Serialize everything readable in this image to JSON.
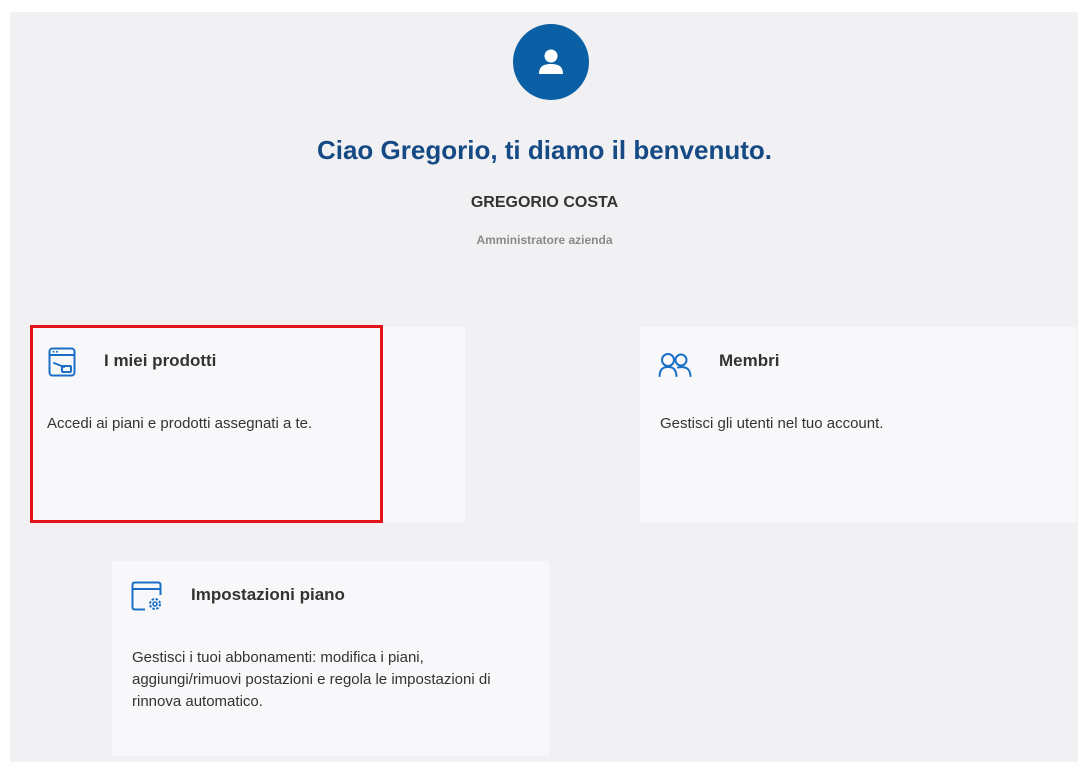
{
  "header": {
    "avatar_icon": "user-icon",
    "greeting": "Ciao Gregorio, ti diamo il benvenuto.",
    "user_name": "GREGORIO COSTA",
    "user_role": "Amministratore azienda"
  },
  "cards": [
    {
      "icon": "products-window-icon",
      "title": "I miei prodotti",
      "description": "Accedi ai piani e prodotti assegnati a te.",
      "highlighted": true
    },
    {
      "icon": "members-icon",
      "title": "Membri",
      "description": "Gestisci gli utenti nel tuo account.",
      "highlighted": false
    },
    {
      "icon": "plan-settings-icon",
      "title": "Impostazioni piano",
      "description": "Gestisci i tuoi abbonamenti: modifica i piani, aggiungi/rimuovi postazioni e regola le impostazioni di rinnova automatico.",
      "highlighted": false
    }
  ],
  "colors": {
    "accent": "#0b5fa5",
    "heading": "#154a85",
    "highlight": "#e3121b",
    "panel_background": "#f1f1f3",
    "card_background": "#f8f8fb"
  }
}
